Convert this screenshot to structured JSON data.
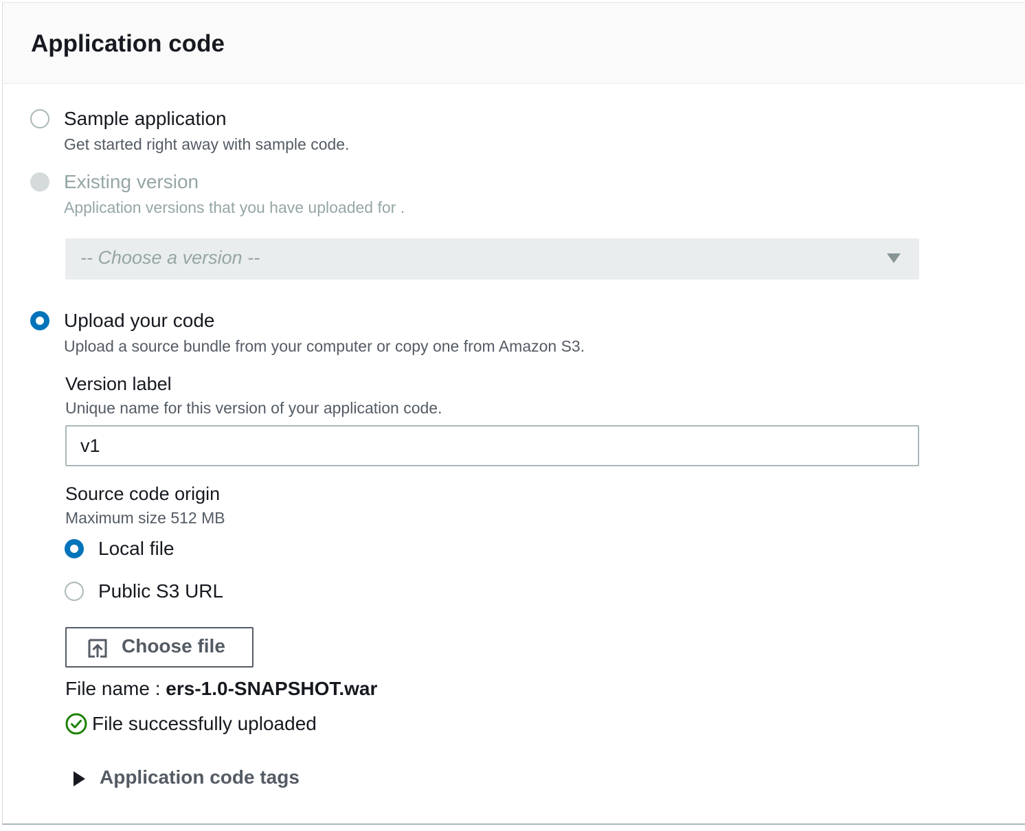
{
  "panel": {
    "title": "Application code"
  },
  "options": {
    "sample": {
      "label": "Sample application",
      "description": "Get started right away with sample code.",
      "selected": false,
      "disabled": false
    },
    "existing": {
      "label": "Existing version",
      "description": "Application versions that you have uploaded for .",
      "selected": false,
      "disabled": true,
      "select_placeholder": "-- Choose a version --"
    },
    "upload": {
      "label": "Upload your code",
      "description": "Upload a source bundle from your computer or copy one from Amazon S3.",
      "selected": true,
      "disabled": false
    }
  },
  "version_label": {
    "label": "Version label",
    "description": "Unique name for this version of your application code.",
    "value": "v1"
  },
  "source_origin": {
    "label": "Source code origin",
    "description": "Maximum size 512 MB",
    "options": [
      {
        "label": "Local file",
        "selected": true
      },
      {
        "label": "Public S3 URL",
        "selected": false
      }
    ]
  },
  "file_upload": {
    "button_label": "Choose file",
    "button_icon": "upload-icon",
    "file_name_label": "File name :",
    "file_name_value": "ers-1.0-SNAPSHOT.war",
    "status_icon": "check-circle-icon",
    "status_text": "File successfully uploaded"
  },
  "tags_expander": {
    "label": "Application code tags",
    "expanded": false
  },
  "colors": {
    "accent": "#0073bb",
    "success": "#1d8102",
    "text": "#16191f",
    "secondary_text": "#545b64",
    "disabled_text": "#95a5a6"
  }
}
